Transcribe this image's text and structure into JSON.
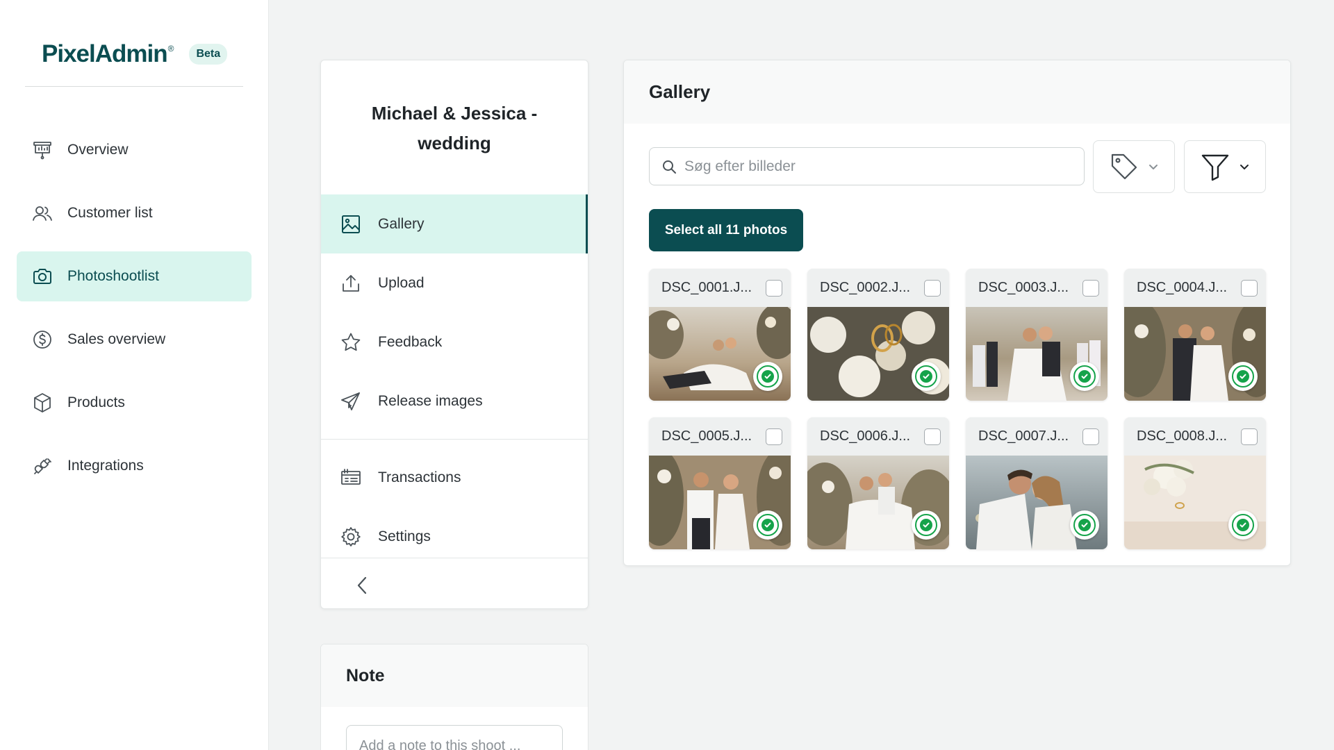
{
  "brand": {
    "name": "PixelAdmin",
    "reg_mark": "®",
    "badge": "Beta"
  },
  "sidebar": {
    "items": [
      {
        "label": "Overview",
        "icon": "presentation-board-icon"
      },
      {
        "label": "Customer list",
        "icon": "users-icon"
      },
      {
        "label": "Photoshootlist",
        "icon": "camera-icon",
        "active": true
      },
      {
        "label": "Sales overview",
        "icon": "dollar-circle-icon"
      },
      {
        "label": "Products",
        "icon": "box-icon"
      },
      {
        "label": "Integrations",
        "icon": "plug-icon"
      }
    ]
  },
  "shoot": {
    "title": "Michael & Jessica - wedding",
    "menu": [
      {
        "label": "Gallery",
        "icon": "image-icon",
        "active": true
      },
      {
        "label": "Upload",
        "icon": "upload-icon"
      },
      {
        "label": "Feedback",
        "icon": "star-icon"
      },
      {
        "label": "Release images",
        "icon": "send-icon"
      },
      {
        "label": "Transactions",
        "icon": "transactions-icon"
      },
      {
        "label": "Settings",
        "icon": "gear-icon"
      }
    ],
    "collapse_icon": "chevron-left-icon"
  },
  "note": {
    "title": "Note",
    "placeholder": "Add a note to this shoot ..."
  },
  "gallery": {
    "title": "Gallery",
    "search_placeholder": "Søg efter billeder",
    "select_all_label": "Select all 11 photos",
    "tag_icon": "tag-icon",
    "filter_icon": "filter-icon",
    "photos": [
      {
        "name": "DSC_0001.J...",
        "status": "approved"
      },
      {
        "name": "DSC_0002.J...",
        "status": "approved"
      },
      {
        "name": "DSC_0003.J...",
        "status": "approved"
      },
      {
        "name": "DSC_0004.J...",
        "status": "approved"
      },
      {
        "name": "DSC_0005.J...",
        "status": "approved"
      },
      {
        "name": "DSC_0006.J...",
        "status": "approved"
      },
      {
        "name": "DSC_0007.J...",
        "status": "approved"
      },
      {
        "name": "DSC_0008.J...",
        "status": "approved"
      }
    ]
  },
  "colors": {
    "brand": "#0b4d51",
    "active_bg": "#d9f5ee",
    "approved": "#15a34a"
  }
}
